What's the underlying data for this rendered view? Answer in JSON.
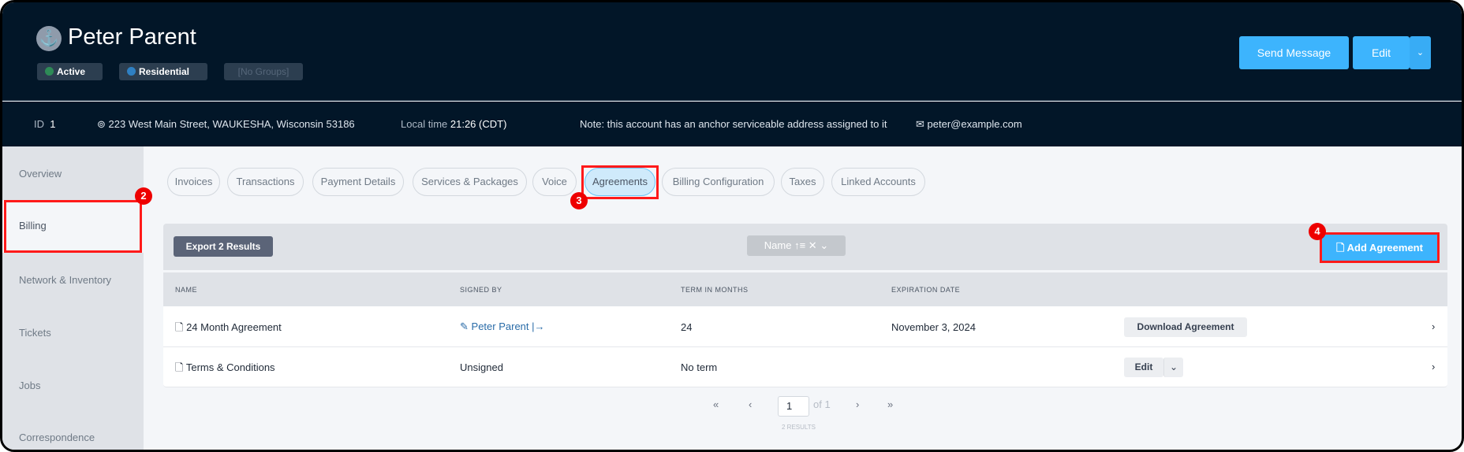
{
  "header": {
    "title": "Peter Parent",
    "avatar_icon": "anchor-icon",
    "badges": [
      {
        "label": "Active",
        "color": "#2e8b57"
      },
      {
        "label": "Residential",
        "color": "#2f80c2"
      },
      {
        "label": "[No Groups]"
      }
    ],
    "send_message": "Send Message",
    "edit": "Edit"
  },
  "info": {
    "id_label": "ID",
    "id_value": "1",
    "address": "223 West Main Street, WAUKESHA, Wisconsin 53186",
    "local_time_label": "Local time",
    "local_time_value": "21:26 (CDT)",
    "note": "Note: this account has an anchor serviceable address assigned to it",
    "email": "peter@example.com"
  },
  "sidebar": {
    "items": [
      {
        "label": "Overview"
      },
      {
        "label": "Billing"
      },
      {
        "label": "Network & Inventory"
      },
      {
        "label": "Tickets"
      },
      {
        "label": "Jobs"
      },
      {
        "label": "Correspondence"
      }
    ]
  },
  "tabs": [
    {
      "label": "Invoices"
    },
    {
      "label": "Transactions"
    },
    {
      "label": "Payment Details"
    },
    {
      "label": "Services & Packages"
    },
    {
      "label": "Voice"
    },
    {
      "label": "Agreements"
    },
    {
      "label": "Billing Configuration"
    },
    {
      "label": "Taxes"
    },
    {
      "label": "Linked Accounts"
    }
  ],
  "toolbar": {
    "export": "Export 2 Results",
    "filter": "Name",
    "add": "Add Agreement"
  },
  "table": {
    "columns": [
      "NAME",
      "SIGNED BY",
      "TERM IN MONTHS",
      "EXPIRATION DATE"
    ],
    "rows": [
      {
        "name": "24 Month Agreement",
        "signed_by": "Peter Parent",
        "term": "24",
        "expiration": "November 3, 2024",
        "action": "Download Agreement"
      },
      {
        "name": "Terms & Conditions",
        "signed_by": "Unsigned",
        "term": "No term",
        "expiration": "",
        "action": "Edit"
      }
    ]
  },
  "pagination": {
    "page": "1",
    "of": "of 1",
    "results": "2 RESULTS"
  },
  "annotations": [
    "2",
    "3",
    "4"
  ],
  "colors": {
    "header_bg": "#021628",
    "accent": "#3db4fd",
    "annotation": "#ff1a1a"
  }
}
